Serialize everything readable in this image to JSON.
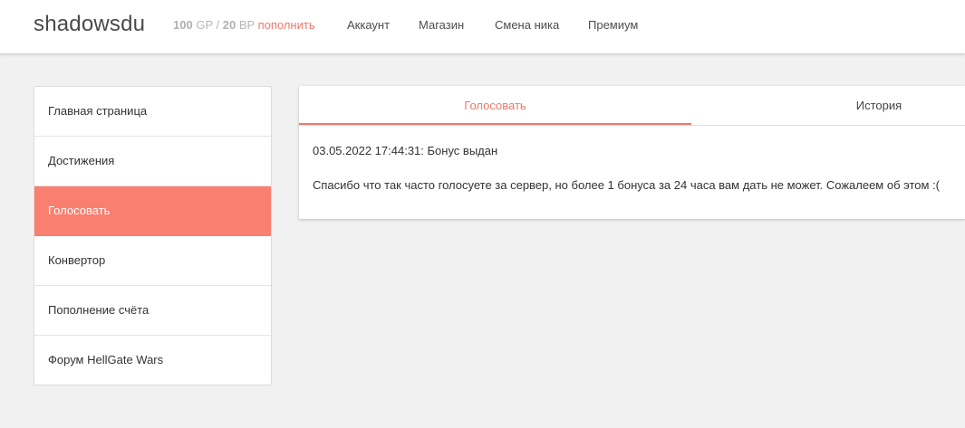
{
  "header": {
    "brand": "shadowsdu",
    "balance": {
      "gp_value": "100",
      "gp_unit": "GP",
      "separator": "/",
      "bp_value": "20",
      "bp_unit": "BP",
      "topup_label": "пополнить"
    },
    "nav": [
      "Аккаунт",
      "Магазин",
      "Смена ника",
      "Премиум"
    ]
  },
  "sidebar": {
    "items": [
      {
        "label": "Главная страница",
        "active": false
      },
      {
        "label": "Достижения",
        "active": false
      },
      {
        "label": "Голосовать",
        "active": true
      },
      {
        "label": "Конвертор",
        "active": false
      },
      {
        "label": "Пополнение счёта",
        "active": false
      },
      {
        "label": "Форум HellGate Wars",
        "active": false
      }
    ]
  },
  "main": {
    "tabs": [
      {
        "label": "Голосовать",
        "active": true
      },
      {
        "label": "История",
        "active": false
      }
    ],
    "messages": [
      "03.05.2022 17:44:31: Бонус выдан",
      "Спасибо что так часто голосуете за сервер, но более 1 бонуса за 24 часа вам дать не может. Сожалеем об этом :("
    ]
  },
  "colors": {
    "accent": "#f0776a",
    "active_bg": "#f97f71",
    "page_bg": "#f1f1f1"
  }
}
